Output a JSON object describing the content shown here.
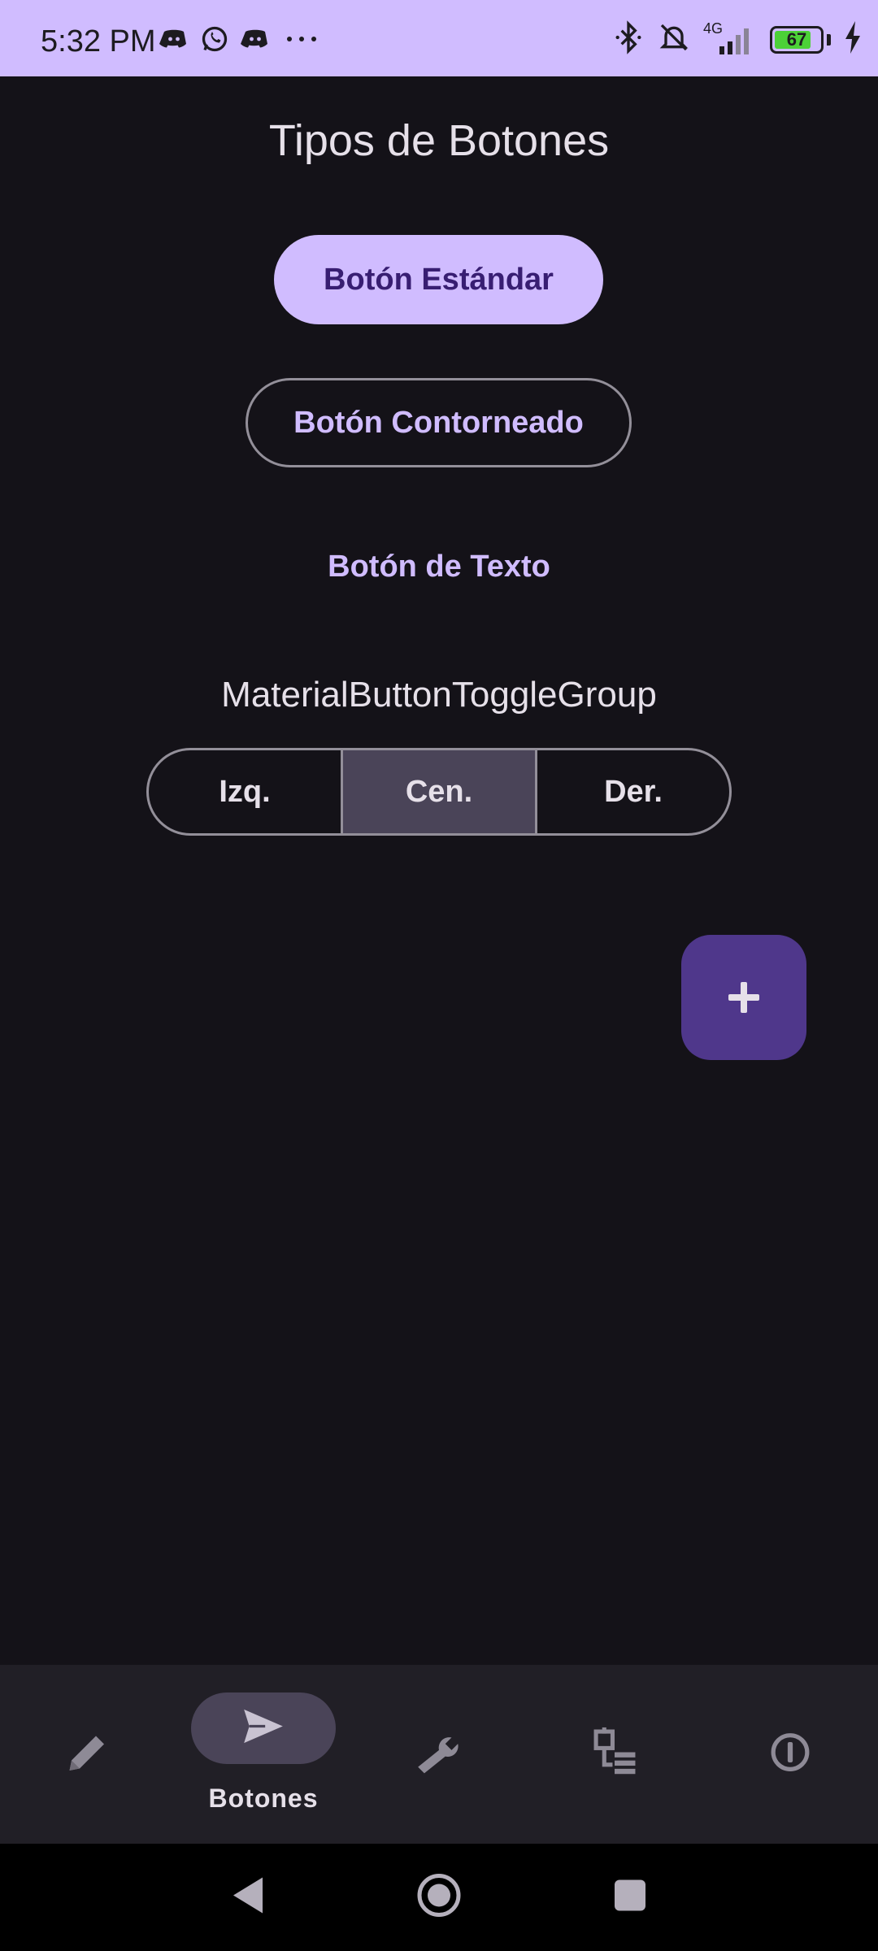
{
  "status_bar": {
    "time": "5:32 PM",
    "network": "4G",
    "battery": "67"
  },
  "screen": {
    "title": "Tipos de Botones",
    "standard_button": "Botón Estándar",
    "outlined_button": "Botón Contorneado",
    "text_button": "Botón de Texto",
    "toggle_group_title": "MaterialButtonToggleGroup",
    "toggle_options": [
      "Izq.",
      "Cen.",
      "Der."
    ],
    "toggle_selected": "Cen.",
    "fab_label": "+"
  },
  "bottom_nav": {
    "items": [
      {
        "icon": "pencil-icon",
        "label": ""
      },
      {
        "icon": "send-icon",
        "label": "Botones"
      },
      {
        "icon": "wrench-icon",
        "label": ""
      },
      {
        "icon": "checklist-icon",
        "label": ""
      },
      {
        "icon": "info-icon",
        "label": ""
      }
    ],
    "active_index": 1
  },
  "colors": {
    "status_bar": "#d0bcff",
    "background": "#141218",
    "primary": "#d0bcff",
    "on_primary": "#381e72",
    "fab": "#4f378b",
    "nav_bar": "#211f26",
    "selected": "#4a4458"
  }
}
